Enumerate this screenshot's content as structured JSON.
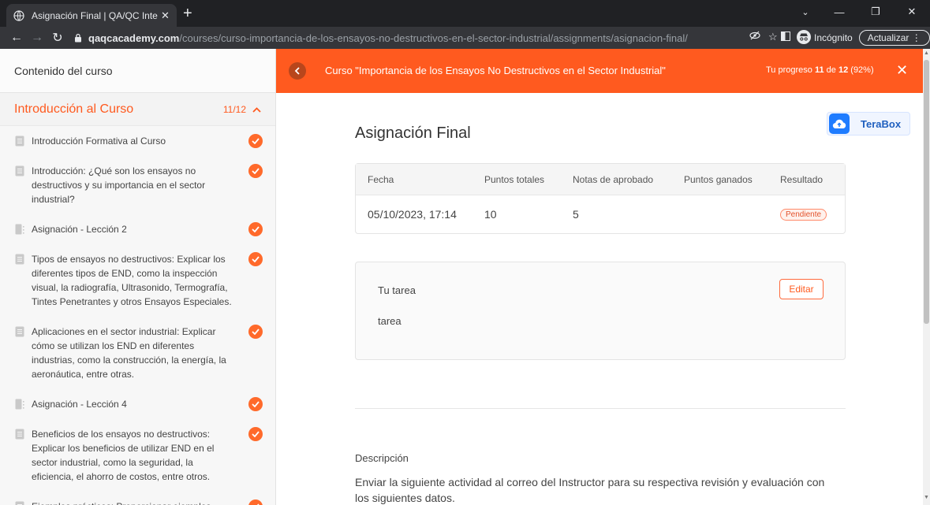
{
  "browser": {
    "tab_title": "Asignación Final | QA/QC Internacional",
    "tab_close": "✕",
    "new_tab": "+",
    "url_host": "qaqcacademy.com",
    "url_path": "/courses/curso-importancia-de-los-ensayos-no-destructivos-en-el-sector-industrial/assignments/asignacion-final/",
    "incognito_label": "Incógnito",
    "update_label": "Actualizar",
    "update_more": "⋮"
  },
  "sidebar": {
    "header": "Contenido del curso",
    "section_title": "Introducción al Curso",
    "section_count": "11/12",
    "lessons": [
      {
        "label": "Introducción Formativa al Curso",
        "icon": "document-icon"
      },
      {
        "label": "Introducción: ¿Qué son los ensayos no destructivos y su importancia en el sector industrial?",
        "icon": "document-icon"
      },
      {
        "label": "Asignación - Lección 2",
        "icon": "assignment-icon"
      },
      {
        "label": "Tipos de ensayos no destructivos: Explicar los diferentes tipos de END, como la inspección visual, la radiografía, Ultrasonido, Termografía, Tintes Penetrantes y otros Ensayos Especiales.",
        "icon": "document-icon"
      },
      {
        "label": "Aplicaciones en el sector industrial: Explicar cómo se utilizan los END en diferentes industrias, como la construcción, la energía, la aeronáutica, entre otras.",
        "icon": "document-icon"
      },
      {
        "label": "Asignación - Lección 4",
        "icon": "assignment-icon"
      },
      {
        "label": "Beneficios de los ensayos no destructivos: Explicar los beneficios de utilizar END en el sector industrial, como la seguridad, la eficiencia, el ahorro de costos, entre otros.",
        "icon": "document-icon"
      },
      {
        "label": "Ejemplos prácticos: Proporcionar ejemplos",
        "icon": "document-icon"
      }
    ]
  },
  "topbar": {
    "course_title": "Curso \"Importancia de los Ensayos No Destructivos en el Sector Industrial\"",
    "progress_prefix": "Tu progreso ",
    "progress_done": "11",
    "progress_of": " de ",
    "progress_total": "12",
    "progress_percent": " (92%)"
  },
  "assignment": {
    "title": "Asignación Final",
    "terabox_label": "TeraBox",
    "table": {
      "headers": [
        "Fecha",
        "Puntos totales",
        "Notas de aprobado",
        "Puntos ganados",
        "Resultado"
      ],
      "row": {
        "fecha": "05/10/2023, 17:14",
        "puntos_totales": "10",
        "notas_aprobado": "5",
        "puntos_ganados": "",
        "resultado": "Pendiente"
      }
    },
    "task_label": "Tu tarea",
    "task_text": "tarea",
    "edit_label": "Editar",
    "description_label": "Descripción",
    "description_text": "Enviar la siguiente actividad al correo del Instructor para su respectiva revisión y evaluación con los siguientes datos."
  },
  "colors": {
    "accent": "#ff5a1f",
    "chrome_dark": "#202124",
    "chrome_mid": "#35363a",
    "terabox_blue": "#1f7cff"
  }
}
